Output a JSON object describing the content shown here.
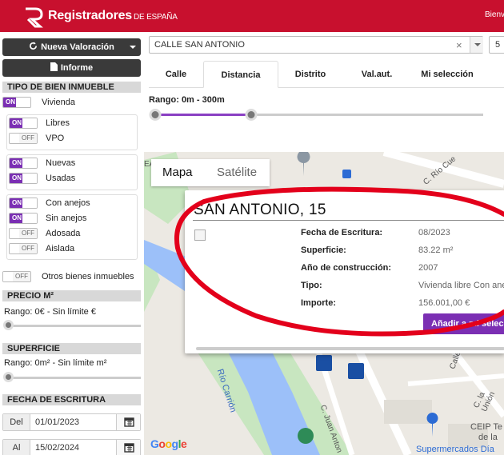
{
  "header": {
    "brand": "Registradores",
    "brand_sub": "DE ESPAÑA",
    "greeting": "Bienv"
  },
  "sidebar": {
    "new_button": "Nueva Valoración",
    "report_button": "Informe",
    "sections": {
      "tipo": "TIPO DE BIEN INMUEBLE",
      "precio": "PRECIO M²",
      "superficie": "SUPERFICIE",
      "fecha": "FECHA DE ESCRITURA"
    },
    "toggles": [
      {
        "label": "Vivienda",
        "state": "ON"
      },
      {
        "label": "Libres",
        "state": "ON"
      },
      {
        "label": "VPO",
        "state": "OFF"
      },
      {
        "label": "Nuevas",
        "state": "ON"
      },
      {
        "label": "Usadas",
        "state": "ON"
      },
      {
        "label": "Con anejos",
        "state": "ON"
      },
      {
        "label": "Sin anejos",
        "state": "ON"
      },
      {
        "label": "Adosada",
        "state": "OFF"
      },
      {
        "label": "Aislada",
        "state": "OFF"
      },
      {
        "label": "Otros bienes inmuebles",
        "state": "OFF"
      }
    ],
    "precio_range": "Rango: 0€ - Sin límite €",
    "superficie_range": "Rango: 0m² - Sin límite m²",
    "date_from_label": "Del",
    "date_from": "01/01/2023",
    "date_to_label": "Al",
    "date_to": "15/02/2024"
  },
  "search": {
    "value": "CALLE SAN ANTONIO",
    "clear": "×",
    "number": "5"
  },
  "tabs": [
    "Calle",
    "Distancia",
    "Distrito",
    "Val.aut.",
    "Mi selección"
  ],
  "active_tab": "Distancia",
  "rango": "Rango: 0m - 300m",
  "map": {
    "type_map": "Mapa",
    "type_sat": "Satélite",
    "google": "Google",
    "labels": {
      "rio": "C. Río Cue",
      "carrion": "Río Carrión",
      "calle1": "Calle",
      "union": "C. la Unión",
      "juan": "C. Juan Anton",
      "ceip": "CEIP Te",
      "ceip2": "de la",
      "super": "Supermercados Día",
      "ea": "EA"
    }
  },
  "popup": {
    "title": "SAN ANTONIO, 15",
    "fields": [
      {
        "label": "Fecha de Escritura:",
        "value": "08/2023"
      },
      {
        "label": "Superficie:",
        "value": "83.22 m²"
      },
      {
        "label": "Año de construcción:",
        "value": "2007"
      },
      {
        "label": "Tipo:",
        "value": "Vivienda libre Con anejos"
      },
      {
        "label": "Importe:",
        "value": "156.001,00 €"
      }
    ],
    "add_button": "Añadir a mi selección"
  },
  "colors": {
    "brand_red": "#c8102e",
    "accent_purple": "#7b2fb3"
  }
}
